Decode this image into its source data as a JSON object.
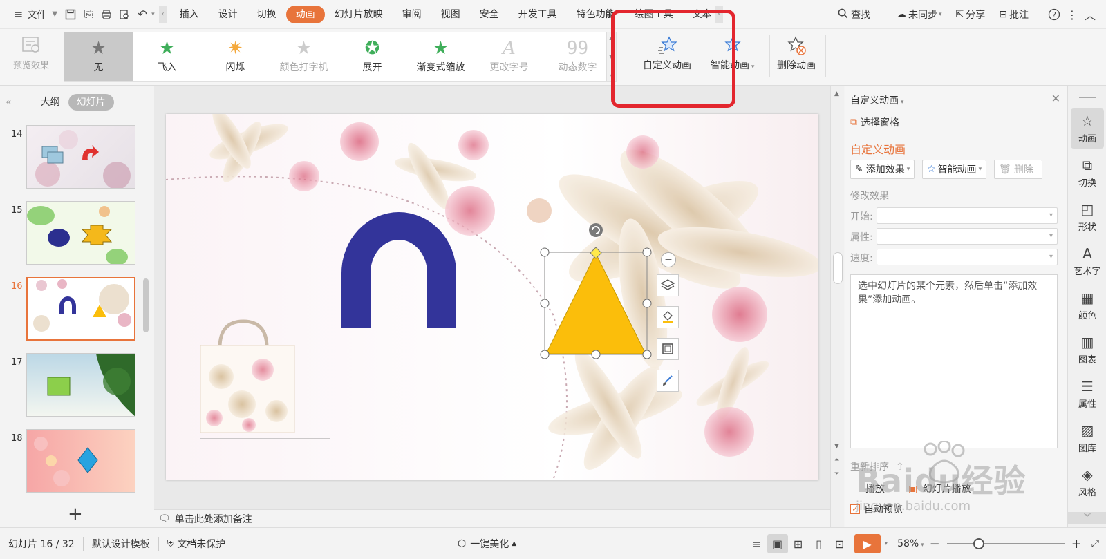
{
  "menubar": {
    "file_label": "文件",
    "tabs": [
      "插入",
      "设计",
      "切换",
      "动画",
      "幻灯片放映",
      "审阅",
      "视图",
      "安全",
      "开发工具",
      "特色功能",
      "绘图工具",
      "文本"
    ],
    "active_tab": "动画",
    "search_label": "查找",
    "sync_label": "未同步",
    "share_label": "分享",
    "comment_label": "批注"
  },
  "ribbon": {
    "preview_label": "预览效果",
    "animations": [
      {
        "label": "无",
        "icon": "star-icon"
      },
      {
        "label": "飞入",
        "icon": "fly-in-star-icon"
      },
      {
        "label": "闪烁",
        "icon": "flash-star-icon"
      },
      {
        "label": "颜色打字机",
        "icon": "typewriter-star-icon"
      },
      {
        "label": "展开",
        "icon": "expand-star-icon"
      },
      {
        "label": "渐变式缩放",
        "icon": "zoom-star-icon"
      },
      {
        "label": "更改字号",
        "icon": "font-size-icon"
      },
      {
        "label": "动态数字",
        "icon": "dynamic-number-icon"
      }
    ],
    "custom_animation_label": "自定义动画",
    "smart_animation_label": "智能动画",
    "delete_animation_label": "删除动画"
  },
  "left_panel": {
    "outline_tab": "大纲",
    "slides_tab": "幻灯片",
    "slides": [
      {
        "num": "14"
      },
      {
        "num": "15"
      },
      {
        "num": "16"
      },
      {
        "num": "17"
      },
      {
        "num": "18"
      }
    ],
    "current_slide": "16"
  },
  "notes": {
    "placeholder": "单击此处添加备注"
  },
  "right_panel": {
    "title": "自定义动画",
    "select_pane_label": "选择窗格",
    "section_title": "自定义动画",
    "add_effect_label": "添加效果",
    "smart_animation_label": "智能动画",
    "delete_label": "删除",
    "modify_effect_label": "修改效果",
    "start_label": "开始:",
    "property_label": "属性:",
    "speed_label": "速度:",
    "hint_text": "选中幻灯片的某个元素，然后单击“添加效果”添加动画。",
    "reorder_label": "重新排序",
    "play_label": "播放",
    "slideshow_label": "幻灯片播放",
    "auto_preview_label": "自动预览"
  },
  "right_sidebar": {
    "items": [
      "动画",
      "切换",
      "形状",
      "艺术字",
      "颜色",
      "图表",
      "属性",
      "图库",
      "风格"
    ]
  },
  "statusbar": {
    "slide_info": "幻灯片 16 / 32",
    "template_label": "默认设计模板",
    "protect_label": "文档未保护",
    "beautify_label": "一键美化",
    "zoom_label": "58%"
  },
  "colors": {
    "accent": "#e8743b",
    "highlight_box": "#e3262e",
    "arch_shape": "#33349a",
    "triangle_shape": "#fbbe0b"
  },
  "watermark": {
    "brand": "Baidu经验",
    "url": "jingyan.baidu.com"
  }
}
